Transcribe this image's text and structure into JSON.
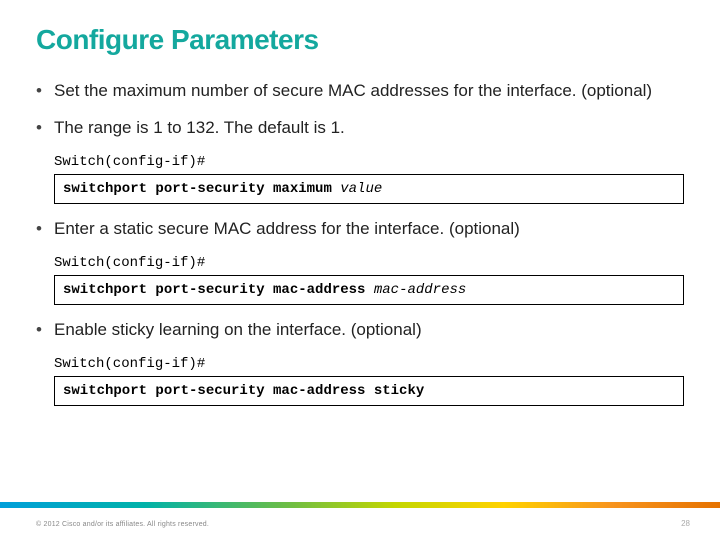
{
  "title": "Configure Parameters",
  "bullets": {
    "b1a": "Set the maximum number of secure MAC addresses for the interface. (optional)",
    "b1b": "The range is 1 to 132. The default is 1.",
    "b2": "Enter a static secure MAC address for the interface. (optional)",
    "b3": "Enable sticky learning on the interface. (optional)"
  },
  "prompts": {
    "p1": "Switch(config-if)#",
    "p2": "Switch(config-if)#",
    "p3": "Switch(config-if)#"
  },
  "cmds": {
    "c1_bold": "switchport port-security maximum ",
    "c1_ital": "value",
    "c2_bold": "switchport port-security mac-address ",
    "c2_ital": "mac-address",
    "c3_bold": "switchport port-security mac-address sticky"
  },
  "footer": "© 2012 Cisco and/or its affiliates. All rights reserved.",
  "page": "28"
}
